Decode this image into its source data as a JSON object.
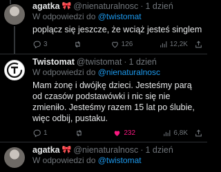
{
  "tweets": [
    {
      "author": "agatka",
      "handle": "@nienaturalnosc",
      "sep": "·",
      "time": "1 dzień",
      "reply_prefix": "W odpowiedzi do",
      "reply_to": "@twistomat",
      "text": "poplącz się jeszcze, że wciąż jesteś singlem",
      "stats": {
        "replies": "3",
        "retweets": "",
        "likes": "126",
        "views": "12,2K"
      }
    },
    {
      "author": "Twistomat",
      "handle": "@twistomat",
      "sep": "·",
      "time": "1 dzień",
      "reply_prefix": "W odpowiedzi do",
      "reply_to": "@nienaturalnosc",
      "text": "Mam żonę i dwójkę dzieci. Jesteśmy parą od czasów podstawówki i nic się nie zmieniło. Jesteśmy razem 15 lat po ślubie, więc odbij, pustaku.",
      "stats": {
        "replies": "1",
        "retweets": "",
        "likes": "232",
        "views": "6,8K"
      }
    },
    {
      "author": "agatka",
      "handle": "@nienaturalnosc",
      "sep": "·",
      "time": "1 dzień",
      "reply_prefix": "W odpowiedzi do",
      "reply_to": "@twistomat"
    }
  ],
  "colors": {
    "background": "#000000",
    "text": "#e7e9ea",
    "muted": "#71767b",
    "link": "#1d9bf0",
    "like_active": "#f91880"
  }
}
